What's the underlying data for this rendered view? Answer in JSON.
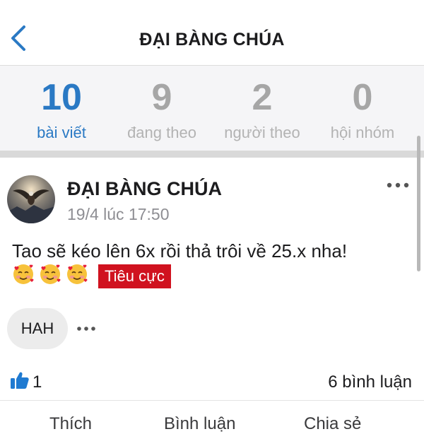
{
  "header": {
    "title": "ĐẠI BÀNG CHÚA",
    "back_icon": "chevron-left-icon"
  },
  "stats": [
    {
      "value": "10",
      "label": "bài viết",
      "active": true
    },
    {
      "value": "9",
      "label": "đang theo",
      "active": false
    },
    {
      "value": "2",
      "label": "người theo",
      "active": false
    },
    {
      "value": "0",
      "label": "hội nhóm",
      "active": false
    }
  ],
  "post": {
    "author": "ĐẠI BÀNG CHÚA",
    "timestamp": "19/4 lúc 17:50",
    "text": "Tao sẽ kéo lên 6x rồi thả trôi về 25.x nha!",
    "emojis": [
      "smiling-face-with-hearts",
      "smiling-face-with-hearts",
      "smiling-face-with-hearts"
    ],
    "sentiment_tag": "Tiêu cực",
    "ticker_chip": "HAH",
    "like_count": "1",
    "comments": "6 bình luận"
  },
  "actions": [
    {
      "label": "Thích",
      "icon": "like-icon"
    },
    {
      "label": "Bình luận",
      "icon": "comment-icon"
    },
    {
      "label": "Chia sẻ",
      "icon": "share-icon"
    }
  ],
  "colors": {
    "accent": "#2a79c4",
    "inactive_stat": "#a6a6a6",
    "sentiment_negative": "#d0121f",
    "like_blue": "#1f7ad1"
  }
}
